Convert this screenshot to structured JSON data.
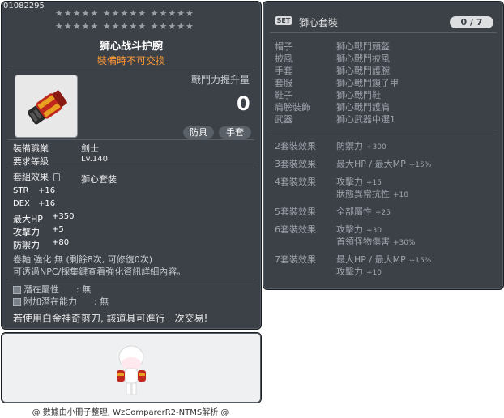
{
  "item": {
    "id": "01082295",
    "stars_row1": "★★★★★  ★★★★★  ★★★★★",
    "stars_row2": "★★★★★  ★★★★★  ★★★★★",
    "name": "狮心战斗护腕",
    "trade_note": "裝備時不可交換",
    "power_label": "戰鬥力提升量",
    "power_value": "0",
    "tags": [
      "防具",
      "手套"
    ],
    "job_label": "裝備職業",
    "job_value": "劍士",
    "level_label": "要求等級",
    "level_value": "Lv.140",
    "set_label": "套組效果",
    "set_value": "獅心套裝",
    "stats": [
      {
        "name": "STR",
        "value": "+16"
      },
      {
        "name": "DEX",
        "value": "+16"
      },
      {
        "name": "最大HP",
        "value": "+350"
      },
      {
        "name": "攻擊力",
        "value": "+5"
      },
      {
        "name": "防禦力",
        "value": "+80"
      }
    ],
    "scroll_line": "卷軸 強化 無 (剩餘8次, 可修復0次)",
    "npc_line": "可透過NPC/採集鍵查看強化資訊詳細內容。",
    "potential_label": "潛在屬性",
    "potential_value": ": 無",
    "bonus_label": "附加潛在能力",
    "bonus_value": ": 無",
    "scissors_line": "若使用白金神奇剪刀, 該道具可進行一次交易!"
  },
  "set": {
    "badge": "SET",
    "title": "獅心套裝",
    "count": "0 / 7",
    "parts": [
      {
        "slot": "帽子",
        "item": "獅心戰鬥頭盔"
      },
      {
        "slot": "披風",
        "item": "獅心戰鬥披風"
      },
      {
        "slot": "手套",
        "item": "獅心戰鬥護腕"
      },
      {
        "slot": "套服",
        "item": "獅心戰鬥鎖子甲"
      },
      {
        "slot": "鞋子",
        "item": "獅心戰鬥鞋"
      },
      {
        "slot": "肩膀裝飾",
        "item": "獅心戰鬥護肩"
      },
      {
        "slot": "武器",
        "item": "獅心武器中選1"
      }
    ],
    "effects": [
      {
        "label": "2套裝效果",
        "lines": [
          {
            "t": "防禦力",
            "n": "+300"
          }
        ]
      },
      {
        "label": "3套裝效果",
        "lines": [
          {
            "t": "最大HP / 最大MP",
            "n": "+15%"
          }
        ]
      },
      {
        "label": "4套裝效果",
        "lines": [
          {
            "t": "攻擊力",
            "n": "+15"
          },
          {
            "t": "狀態異常抗性",
            "n": "+10"
          }
        ]
      },
      {
        "label": "5套裝效果",
        "lines": [
          {
            "t": "全部屬性",
            "n": "+25"
          }
        ]
      },
      {
        "label": "6套裝效果",
        "lines": [
          {
            "t": "攻擊力",
            "n": "+30"
          },
          {
            "t": "首領怪物傷害",
            "n": "+30%"
          }
        ]
      },
      {
        "label": "7套裝效果",
        "lines": [
          {
            "t": "最大HP / 最大MP",
            "n": "+15%"
          },
          {
            "t": "攻擊力",
            "n": "+10"
          }
        ]
      }
    ]
  },
  "credit": "@ 數據由小冊子整理, WzComparerR2-NTMS解析 @"
}
